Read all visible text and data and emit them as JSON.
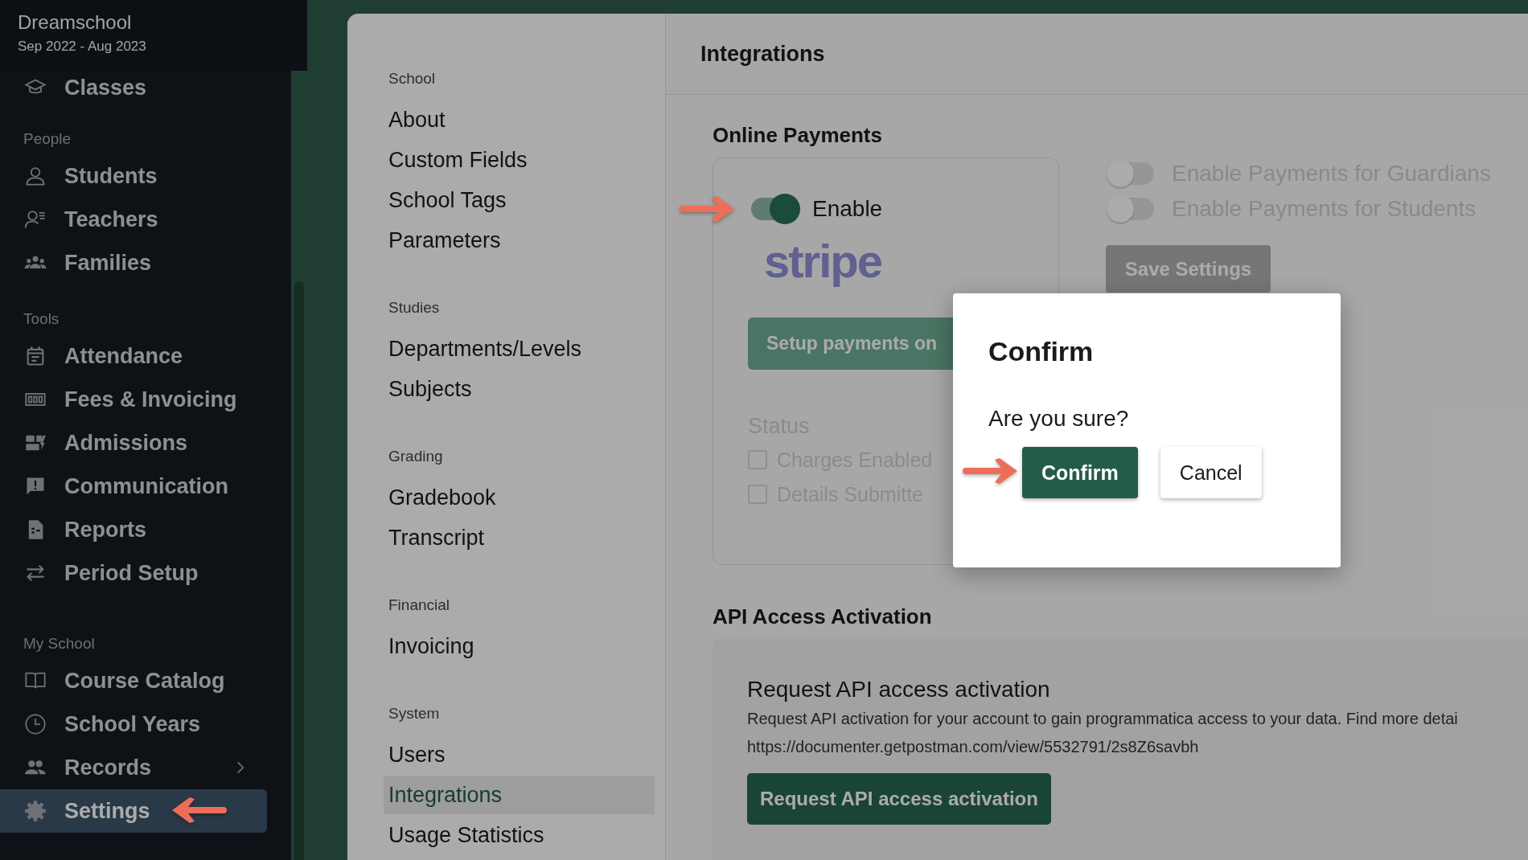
{
  "sidebar": {
    "school": "Dreamschool",
    "period": "Sep 2022 - Aug 2023",
    "groups": [
      {
        "items": [
          {
            "label": "Classes",
            "selected": false,
            "expandable": false
          }
        ]
      },
      {
        "label": "People",
        "items": [
          {
            "label": "Students",
            "selected": false,
            "expandable": false
          },
          {
            "label": "Teachers",
            "selected": false,
            "expandable": false
          },
          {
            "label": "Families",
            "selected": false,
            "expandable": false
          }
        ]
      },
      {
        "label": "Tools",
        "items": [
          {
            "label": "Attendance",
            "selected": false,
            "expandable": false
          },
          {
            "label": "Fees & Invoicing",
            "selected": false,
            "expandable": false
          },
          {
            "label": "Admissions",
            "selected": false,
            "expandable": false
          },
          {
            "label": "Communication",
            "selected": false,
            "expandable": false
          },
          {
            "label": "Reports",
            "selected": false,
            "expandable": false
          },
          {
            "label": "Period Setup",
            "selected": false,
            "expandable": false
          }
        ]
      },
      {
        "label": "My School",
        "items": [
          {
            "label": "Course Catalog",
            "selected": false,
            "expandable": false
          },
          {
            "label": "School Years",
            "selected": false,
            "expandable": false
          },
          {
            "label": "Records",
            "selected": false,
            "expandable": true
          },
          {
            "label": "Settings",
            "selected": true,
            "expandable": false
          }
        ]
      }
    ]
  },
  "settings_nav": {
    "sections": [
      {
        "label": "School",
        "items": [
          {
            "label": "About",
            "selected": false
          },
          {
            "label": "Custom Fields",
            "selected": false
          },
          {
            "label": "School Tags",
            "selected": false
          },
          {
            "label": "Parameters",
            "selected": false
          }
        ]
      },
      {
        "label": "Studies",
        "items": [
          {
            "label": "Departments/Levels",
            "selected": false
          },
          {
            "label": "Subjects",
            "selected": false
          }
        ]
      },
      {
        "label": "Grading",
        "items": [
          {
            "label": "Gradebook",
            "selected": false
          },
          {
            "label": "Transcript",
            "selected": false
          }
        ]
      },
      {
        "label": "Financial",
        "items": [
          {
            "label": "Invoicing",
            "selected": false
          }
        ]
      },
      {
        "label": "System",
        "items": [
          {
            "label": "Users",
            "selected": false
          },
          {
            "label": "Integrations",
            "selected": true
          },
          {
            "label": "Usage Statistics",
            "selected": false
          }
        ]
      }
    ]
  },
  "page_title": "Integrations",
  "online_payments": {
    "heading": "Online Payments",
    "enable": {
      "label": "Enable",
      "on": true
    },
    "provider_logo": "stripe",
    "setup_button": {
      "label": "Setup payments on",
      "disabled": true
    },
    "status": {
      "label": "Status",
      "checks": [
        {
          "label": "Charges Enabled",
          "checked": false
        },
        {
          "label": "Details Submitte",
          "checked": false
        }
      ]
    },
    "toggles": [
      {
        "label": "Enable Payments for Guardians",
        "on": false
      },
      {
        "label": "Enable Payments for Students",
        "on": false
      }
    ],
    "save_button": {
      "label": "Save Settings",
      "disabled": true
    }
  },
  "api_access": {
    "heading": "API Access Activation",
    "title": "Request API access activation",
    "description": "Request API activation for your account to gain programmatica access to your data. Find more detai",
    "url": "https://documenter.getpostman.com/view/5532791/2s8Z6savbh",
    "button": "Request API access activation"
  },
  "dialog": {
    "title": "Confirm",
    "message": "Are you sure?",
    "buttons": [
      {
        "label": "Confirm",
        "kind": "primary"
      },
      {
        "label": "Cancel",
        "kind": "secondary"
      }
    ]
  }
}
